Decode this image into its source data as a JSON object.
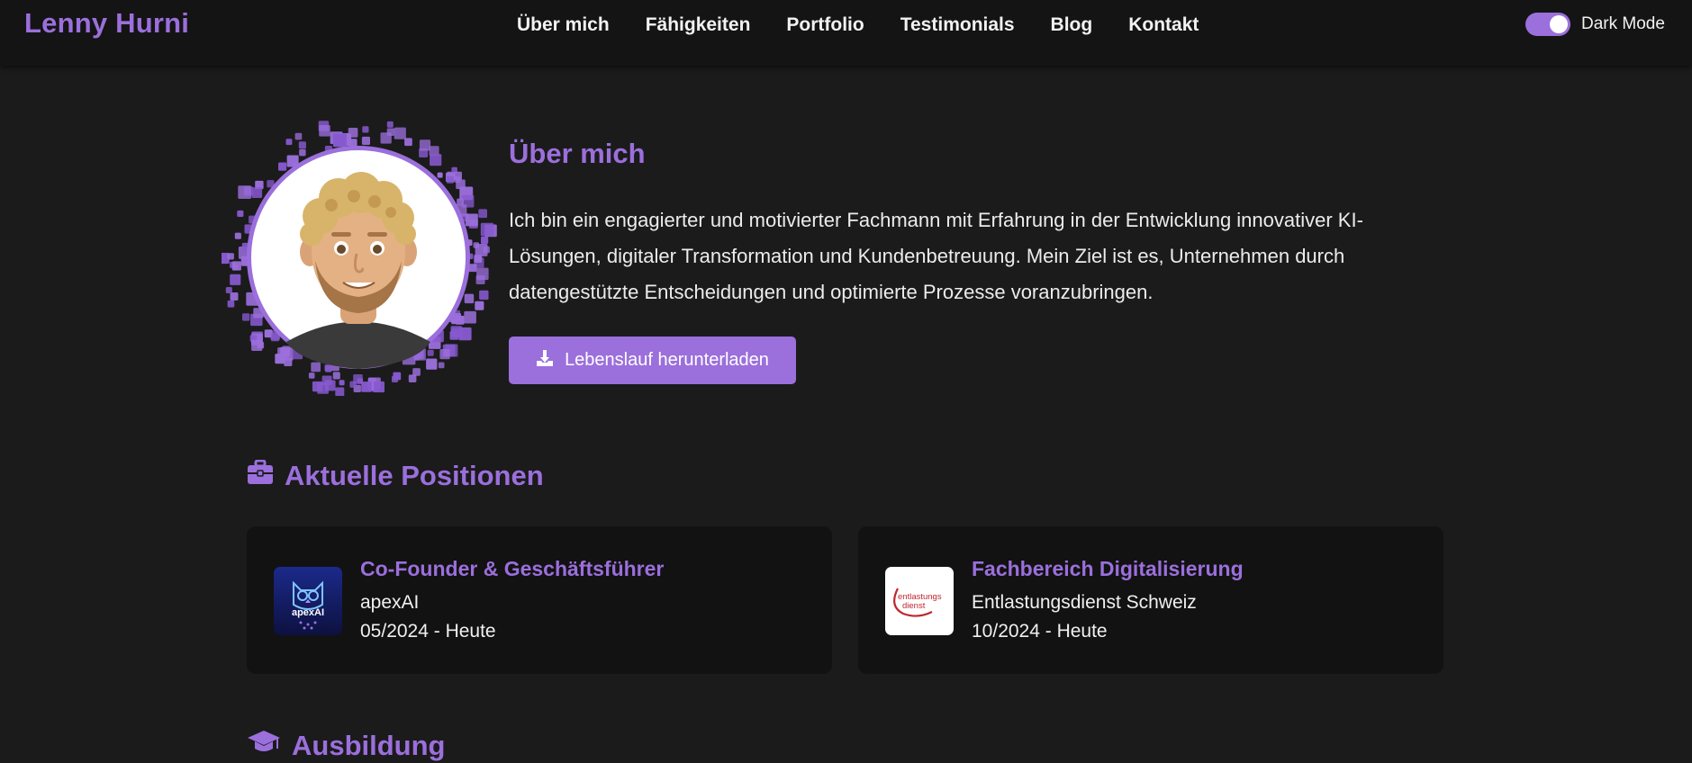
{
  "header": {
    "brand": "Lenny Hurni",
    "nav": [
      {
        "label": "Über mich"
      },
      {
        "label": "Fähigkeiten"
      },
      {
        "label": "Portfolio"
      },
      {
        "label": "Testimonials"
      },
      {
        "label": "Blog"
      },
      {
        "label": "Kontakt"
      }
    ],
    "theme_toggle": {
      "label": "Dark Mode",
      "on": true
    }
  },
  "about": {
    "title": "Über mich",
    "text": "Ich bin ein engagierter und motivierter Fachmann mit Erfahrung in der Entwicklung innovativer KI-Lösungen, digitaler Transformation und Kundenbetreuung. Mein Ziel ist es, Unternehmen durch datengestützte Entscheidungen und optimierte Prozesse voranzubringen.",
    "download_button": "Lebenslauf herunterladen",
    "avatar_icon": "memoji-avatar"
  },
  "positions": {
    "heading": "Aktuelle Positionen",
    "heading_icon": "briefcase-icon",
    "items": [
      {
        "title": "Co-Founder & Geschäftsführer",
        "company": "apexAI",
        "date": "05/2024 - Heute",
        "logo_text": "apexAI",
        "logo_icon": "owl-logo"
      },
      {
        "title": "Fachbereich Digitalisierung",
        "company": "Entlastungsdienst Schweiz",
        "date": "10/2024 - Heute",
        "logo_text_1": "entlastungs",
        "logo_text_2": "dienst",
        "logo_icon": "entlastungsdienst-logo"
      }
    ]
  },
  "education": {
    "heading": "Ausbildung",
    "heading_icon": "graduation-cap-icon"
  },
  "colors": {
    "accent": "#9b6fdc",
    "background": "#1b1b1b",
    "navbar": "#141414",
    "card": "#121212",
    "text": "#f0f0f0"
  }
}
